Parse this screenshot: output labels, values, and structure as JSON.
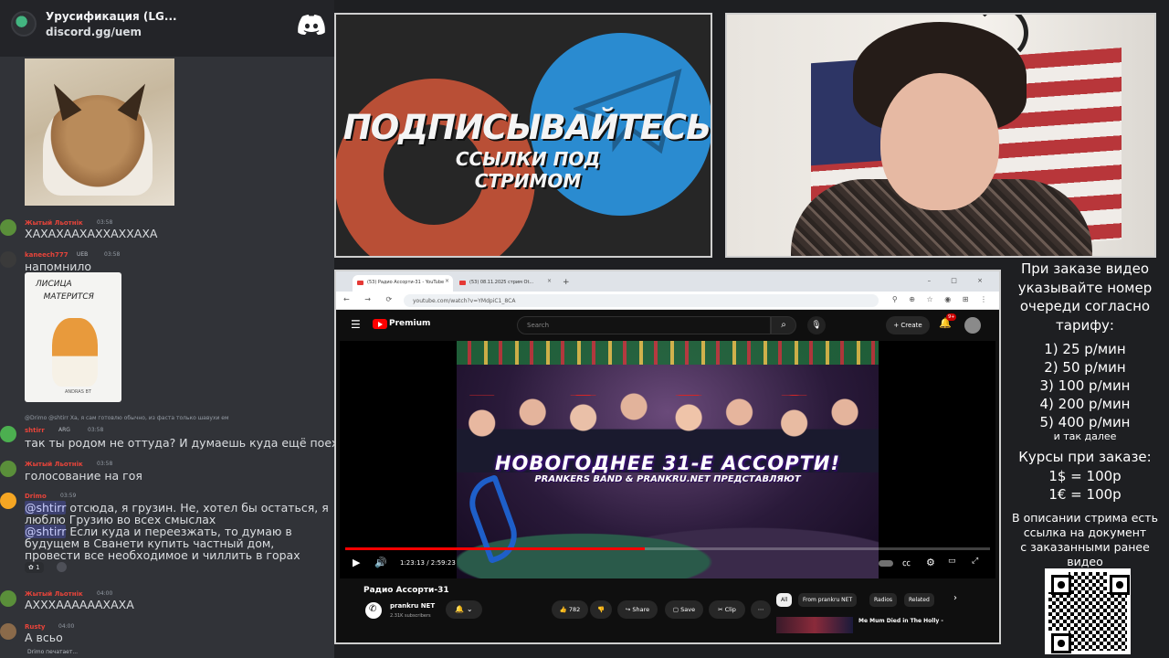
{
  "discord": {
    "server_name": "Урусификация (LG...",
    "invite_link": "discord.gg/uem",
    "messages": [
      {
        "user": "Жытый Льотнік",
        "badge": "",
        "time": "03:58",
        "text": "ХАХАХААХАХХАХХАХА",
        "color": "#e8443a"
      },
      {
        "user": "kaneech777",
        "badge": "UEB",
        "time": "03:58",
        "text": "напомнило",
        "color": "#e8443a"
      },
      {
        "user": "shtirr",
        "badge": "ARG",
        "time": "03:58",
        "reply": "@Drimo @shtirr Ха, я сам готовлю обычно, из фаста только шавухи ем",
        "text": "так ты родом не оттуда? И думаешь куда ещё поехать?",
        "color": "#e8443a"
      },
      {
        "user": "Жытый Льотнік",
        "badge": "",
        "time": "03:58",
        "text": "голосование на гоя",
        "color": "#e8443a"
      },
      {
        "user": "Drimo",
        "badge": "",
        "time": "03:59",
        "mention1": "@shtirr",
        "text1": " отсюда, я грузин. Не, хотел бы остаться, я люблю Грузию во всех смыслах",
        "mention2": "@shtirr",
        "text2": " Если куда и переезжать, то думаю в будущем в Сванети купить частный дом, провести все необходимое и чиллить в горах",
        "reaction_count": "1",
        "color": "#e8443a"
      },
      {
        "user": "Жытый Льотнік",
        "badge": "",
        "time": "04:00",
        "text": "АХХХААААААХАХА",
        "color": "#e8443a"
      },
      {
        "user": "Rusty",
        "badge": "",
        "time": "04:00",
        "text": "А всьо",
        "color": "#e8443a"
      }
    ],
    "typing": "Drimo печатает...",
    "sticker_caption": "ЛИСИЦА\nМАТЕРИТСЯ",
    "sticker_foot": "ANDRAS BT"
  },
  "banner": {
    "headline": "ПОДПИСЫВАЙТЕСЬ",
    "subline": "ССЫЛКИ ПОД СТРИМОМ"
  },
  "browser": {
    "tabs": [
      {
        "label": "(53) Радио Ассорти-31 - YouTube",
        "close": "×"
      },
      {
        "label": "(53) 08.11.2025 стрим Ot...",
        "close": "×"
      }
    ],
    "new_tab": "+",
    "window_controls": "–  □  ×",
    "nav_icons": "←  →  ⟳  ⌂",
    "url": "youtube.com/watch?v=YMdpiC1_8CA",
    "ext_icons": "⚲ ⊕ ☆ ◉ ⊞ ⋮"
  },
  "youtube": {
    "brand": "Premium",
    "search_placeholder": "Search",
    "create": "+ Create",
    "notifications": "9+",
    "player": {
      "thumb_title": "НОВОГОДНЕЕ 31-Е АССОРТИ!",
      "thumb_subtitle": "PRANKERS BAND & PRANKRU.NET ПРЕДСТАВЛЯЮТ",
      "time": "1:23:13 / 2:59:23",
      "progress": 0.464
    },
    "video_title": "Радио Ассорти-31",
    "channel": "prankru NET",
    "subscribers": "2.31K subscribers",
    "likes": "782",
    "share": "Share",
    "save": "Save",
    "clip": "Clip",
    "chips": [
      "All",
      "From prankru NET",
      "Radios",
      "Related"
    ],
    "next_video": "Me Mum Died in The Holly -"
  },
  "pricing": {
    "head": [
      "При заказе видео",
      "указывайте номер",
      "очереди согласно",
      "тарифу:"
    ],
    "tiers": [
      "1) 25 р/мин",
      "2) 50 р/мин",
      "3) 100 р/мин",
      "4) 200 р/мин",
      "5) 400 р/мин"
    ],
    "etc": "и так далее",
    "rates": [
      "Курсы при заказе:",
      "1$ = 100р",
      "1€ = 100р"
    ],
    "note": [
      "В описании стрима есть",
      "ссылка на документ",
      "с заказанными ранее",
      "видео"
    ]
  }
}
